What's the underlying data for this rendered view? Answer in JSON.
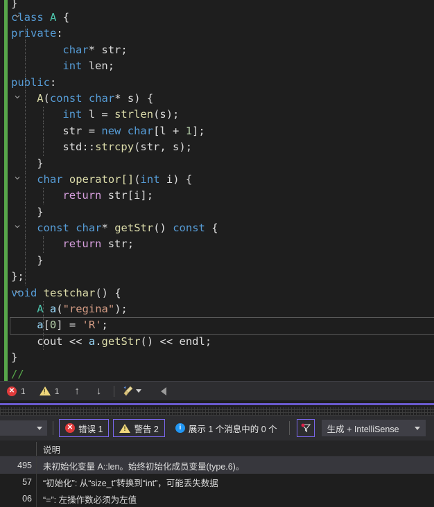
{
  "editor": {
    "language": "cpp",
    "theme_bg": "#1e1e1e",
    "change_bar_color": "#57a64a",
    "lines": [
      {
        "n": 0,
        "segments": [
          {
            "t": "pln",
            "s": "}"
          }
        ]
      },
      {
        "n": 1,
        "segments": [
          {
            "t": "kw",
            "s": "class"
          },
          {
            "t": "pln",
            "s": " "
          },
          {
            "t": "type",
            "s": "A"
          },
          {
            "t": "pln",
            "s": " {"
          }
        ]
      },
      {
        "n": 2,
        "segments": [
          {
            "t": "kw",
            "s": "private"
          },
          {
            "t": "pln",
            "s": ":"
          }
        ]
      },
      {
        "n": 3,
        "segments": [
          {
            "t": "kw",
            "s": "char"
          },
          {
            "t": "pln",
            "s": "* str;"
          }
        ]
      },
      {
        "n": 4,
        "segments": [
          {
            "t": "kw",
            "s": "int"
          },
          {
            "t": "pln",
            "s": " len;"
          }
        ]
      },
      {
        "n": 5,
        "segments": [
          {
            "t": "kw",
            "s": "public"
          },
          {
            "t": "pln",
            "s": ":"
          }
        ]
      },
      {
        "n": 6,
        "segments": [
          {
            "t": "fn",
            "s": "A"
          },
          {
            "t": "pln",
            "s": "("
          },
          {
            "t": "kw",
            "s": "const"
          },
          {
            "t": "pln",
            "s": " "
          },
          {
            "t": "kw",
            "s": "char"
          },
          {
            "t": "pln",
            "s": "* s) {"
          }
        ]
      },
      {
        "n": 7,
        "segments": [
          {
            "t": "kw",
            "s": "int"
          },
          {
            "t": "pln",
            "s": " l = "
          },
          {
            "t": "fn",
            "s": "strlen"
          },
          {
            "t": "pln",
            "s": "(s);"
          }
        ]
      },
      {
        "n": 8,
        "segments": [
          {
            "t": "pln",
            "s": "str = "
          },
          {
            "t": "kw",
            "s": "new"
          },
          {
            "t": "pln",
            "s": " "
          },
          {
            "t": "kw",
            "s": "char"
          },
          {
            "t": "pln",
            "s": "[l + "
          },
          {
            "t": "num",
            "s": "1"
          },
          {
            "t": "pln",
            "s": "];"
          }
        ]
      },
      {
        "n": 9,
        "segments": [
          {
            "t": "pln",
            "s": "std::"
          },
          {
            "t": "fn",
            "s": "strcpy"
          },
          {
            "t": "pln",
            "s": "(str, s);"
          }
        ]
      },
      {
        "n": 10,
        "segments": [
          {
            "t": "pln",
            "s": "}"
          }
        ]
      },
      {
        "n": 11,
        "segments": [
          {
            "t": "kw",
            "s": "char"
          },
          {
            "t": "pln",
            "s": " "
          },
          {
            "t": "fn",
            "s": "operator[]"
          },
          {
            "t": "pln",
            "s": "("
          },
          {
            "t": "kw",
            "s": "int"
          },
          {
            "t": "pln",
            "s": " i) {"
          }
        ]
      },
      {
        "n": 12,
        "segments": [
          {
            "t": "ctl",
            "s": "return"
          },
          {
            "t": "pln",
            "s": " str[i];"
          }
        ]
      },
      {
        "n": 13,
        "segments": [
          {
            "t": "pln",
            "s": "}"
          }
        ]
      },
      {
        "n": 14,
        "segments": [
          {
            "t": "kw",
            "s": "const"
          },
          {
            "t": "pln",
            "s": " "
          },
          {
            "t": "kw",
            "s": "char"
          },
          {
            "t": "pln",
            "s": "* "
          },
          {
            "t": "fn",
            "s": "getStr"
          },
          {
            "t": "pln",
            "s": "() "
          },
          {
            "t": "kw",
            "s": "const"
          },
          {
            "t": "pln",
            "s": " {"
          }
        ]
      },
      {
        "n": 15,
        "segments": [
          {
            "t": "ctl",
            "s": "return"
          },
          {
            "t": "pln",
            "s": " str;"
          }
        ]
      },
      {
        "n": 16,
        "segments": [
          {
            "t": "pln",
            "s": "}"
          }
        ]
      },
      {
        "n": 17,
        "segments": [
          {
            "t": "pln",
            "s": "};"
          }
        ]
      },
      {
        "n": 18,
        "segments": [
          {
            "t": "kw",
            "s": "void"
          },
          {
            "t": "pln",
            "s": " "
          },
          {
            "t": "fn",
            "s": "testchar"
          },
          {
            "t": "pln",
            "s": "() {"
          }
        ]
      },
      {
        "n": 19,
        "segments": [
          {
            "t": "type",
            "s": "A"
          },
          {
            "t": "pln",
            "s": " "
          },
          {
            "t": "var",
            "s": "a"
          },
          {
            "t": "pln",
            "s": "("
          },
          {
            "t": "str",
            "s": "\"regina\""
          },
          {
            "t": "pln",
            "s": ");"
          }
        ]
      },
      {
        "n": 20,
        "segments": [
          {
            "t": "var",
            "s": "a"
          },
          {
            "t": "pln",
            "s": "["
          },
          {
            "t": "num",
            "s": "0"
          },
          {
            "t": "pln",
            "s": "] = "
          },
          {
            "t": "str",
            "s": "'R'"
          },
          {
            "t": "pln",
            "s": ";"
          }
        ]
      },
      {
        "n": 21,
        "segments": [
          {
            "t": "pln",
            "s": "cout << "
          },
          {
            "t": "var",
            "s": "a"
          },
          {
            "t": "pln",
            "s": "."
          },
          {
            "t": "fn",
            "s": "getStr"
          },
          {
            "t": "pln",
            "s": "() << endl;"
          }
        ]
      },
      {
        "n": 22,
        "segments": [
          {
            "t": "pln",
            "s": "}"
          }
        ]
      },
      {
        "n": 23,
        "segments": [
          {
            "t": "cmt",
            "s": "//"
          }
        ]
      }
    ],
    "raw_text": [
      "}",
      "class A {",
      "private:",
      "    char* str;",
      "    int len;",
      "public:",
      "    A(const char* s) {",
      "        int l = strlen(s);",
      "        str = new char[l + 1];",
      "        std::strcpy(str, s);",
      "    }",
      "    char operator[](int i) {",
      "        return str[i];",
      "    }",
      "    const char* getStr() const {",
      "        return str;",
      "    }",
      "};",
      "void testchar() {",
      "    A a(\"regina\");",
      "    a[0] = 'R';",
      "    cout << a.getStr() << endl;",
      "}",
      "//"
    ],
    "current_line_index": 20
  },
  "mini_toolbar": {
    "error_icon": "error-circle-icon",
    "error_count": "1",
    "warning_icon": "warning-triangle-icon",
    "warning_count": "1",
    "prev_icon": "arrow-up-icon",
    "prev_glyph": "↑",
    "next_icon": "arrow-down-icon",
    "next_glyph": "↓",
    "cleanup_icon": "broom-icon",
    "collapse_icon": "triangle-left-icon"
  },
  "error_list": {
    "toolbar": {
      "left_combo_value": "",
      "errors_label": "错误 1",
      "warnings_label": "警告 2",
      "messages_label": "展示 1 个消息中的 0 个",
      "filter_icon": "filter-funnel-icon",
      "scope_value": "生成 + IntelliSense"
    },
    "columns": [
      "",
      "说明"
    ],
    "rows": [
      {
        "code": "495",
        "message": "未初始化变量 A::len。始终初始化成员变量(type.6)。",
        "selected": true
      },
      {
        "code": "57",
        "message": "“初始化”: 从“size_t”转换到“int”，可能丢失数据",
        "selected": false
      },
      {
        "code": "06",
        "message": "“=”: 左操作数必须为左值",
        "selected": false
      }
    ]
  },
  "colors": {
    "background": "#1e1e1e",
    "keyword": "#569cd6",
    "type": "#4ec9b0",
    "control": "#d8a0df",
    "string": "#d69d85",
    "function": "#dcdcaa",
    "number": "#b5cea8",
    "comment": "#57a64a",
    "plain": "#dcdcdc",
    "variable": "#9cdcfe",
    "accent": "#7b68ee",
    "error": "#e03b3b",
    "warning": "#f0d77b",
    "info": "#2196f3",
    "change_bar": "#57a64a"
  }
}
